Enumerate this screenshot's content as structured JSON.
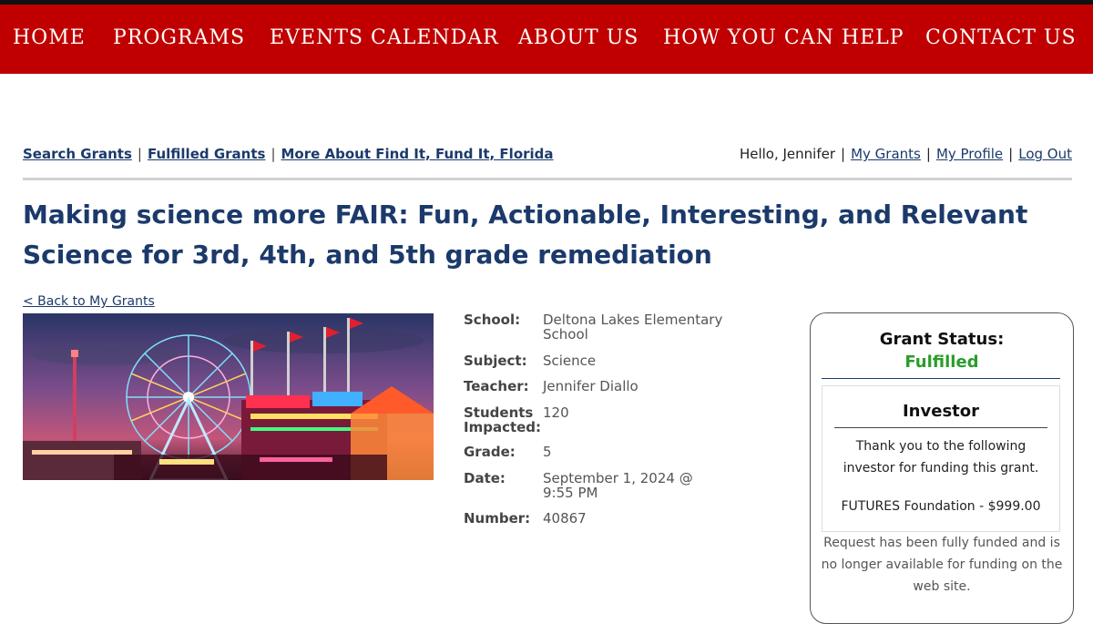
{
  "nav": {
    "items": [
      "HOME",
      "PROGRAMS",
      "EVENTS CALENDAR",
      "ABOUT US",
      "HOW YOU CAN HELP",
      "CONTACT US"
    ]
  },
  "subnav": {
    "search": "Search Grants",
    "fulfilled": "Fulfilled Grants",
    "more": "More About Find It, Fund It, Florida",
    "separator": "|"
  },
  "user": {
    "greeting": "Hello, Jennifer",
    "my_grants": "My Grants",
    "my_profile": "My Profile",
    "logout": "Log Out",
    "separator": "|"
  },
  "grant": {
    "title": "Making science more FAIR: Fun, Actionable, Interesting, and Relevant Science for 3rd, 4th, and 5th grade remediation",
    "back_link": "< Back to My Grants",
    "details": [
      {
        "label": "School:",
        "value": "Deltona Lakes Elementary School"
      },
      {
        "label": "Subject:",
        "value": "Science"
      },
      {
        "label": "Teacher:",
        "value": "Jennifer Diallo"
      },
      {
        "label": "Students Impacted:",
        "value": "120"
      },
      {
        "label": "Grade:",
        "value": "5"
      },
      {
        "label": "Date:",
        "value": "September 1, 2024 @ 9:55 PM"
      },
      {
        "label": "Number:",
        "value": "40867"
      }
    ]
  },
  "status": {
    "heading": "Grant Status:",
    "value": "Fulfilled",
    "investor_heading": "Investor",
    "thanks": "Thank you to the following investor for funding this grant.",
    "investor": "FUTURES Foundation - $999.00",
    "note": "Request has been fully funded and is no longer available for funding on the web site."
  },
  "colors": {
    "nav_red": "#c00000",
    "link_blue": "#1b3a6b",
    "fulfilled_green": "#2a9d2a"
  }
}
